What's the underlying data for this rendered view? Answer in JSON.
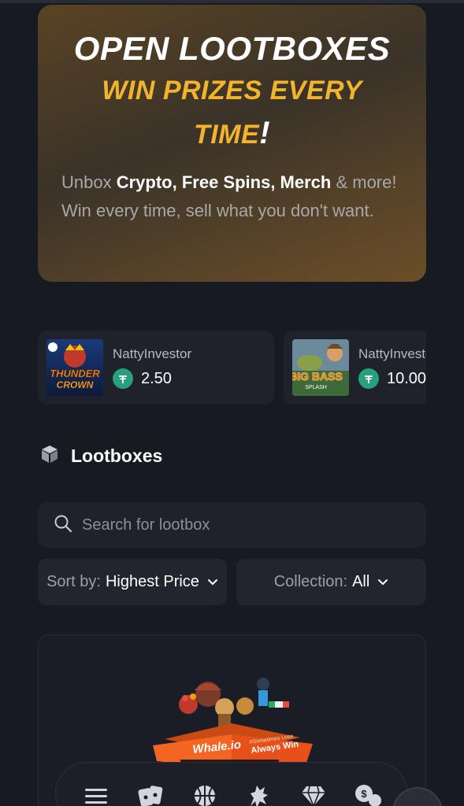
{
  "hero": {
    "title": "OPEN LOOTBOXES",
    "subtitle": "WIN PRIZES EVERY TIME",
    "subtitle_mark": "!",
    "desc_pre": "Unbox ",
    "desc_bold": "Crypto, Free Spins, Merch",
    "desc_post": " & more! Win every time, sell what you don't want."
  },
  "wins": [
    {
      "user": "NattyInvestor",
      "amount": "2.50",
      "game": "THUNDER CROWN"
    },
    {
      "user": "NattyInvestor",
      "amount": "10.00",
      "game": "BIG BASS SPLASH"
    }
  ],
  "section": {
    "title": "Lootboxes"
  },
  "search": {
    "placeholder": "Search for lootbox"
  },
  "filters": {
    "sort_key": "Sort by:",
    "sort_value": "Highest Price",
    "collection_key": "Collection:",
    "collection_value": "All"
  },
  "lootbox": {
    "brand": "Whale.io",
    "tagline_small": "#Sometimes Lose",
    "tagline_big": "Always Win"
  },
  "colors": {
    "accent": "#f3b32c",
    "tether": "#26a17b",
    "background": "#171a21",
    "card": "#1f222b"
  },
  "nav": [
    "menu-icon",
    "cards-icon",
    "basketball-icon",
    "dragon-icon",
    "diamond-icon",
    "coins-chat-icon"
  ]
}
